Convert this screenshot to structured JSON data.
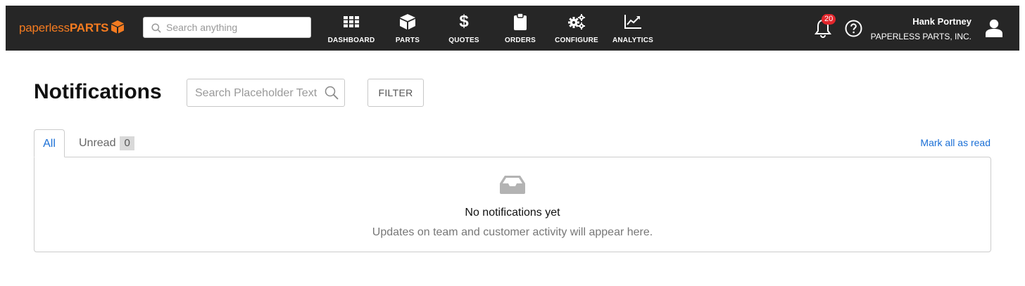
{
  "header": {
    "logo": {
      "light": "paperless",
      "bold": "PARTS"
    },
    "search_placeholder": "Search anything",
    "nav": [
      {
        "label": "DASHBOARD",
        "icon": "grid-icon"
      },
      {
        "label": "PARTS",
        "icon": "cube-icon"
      },
      {
        "label": "QUOTES",
        "icon": "dollar-icon"
      },
      {
        "label": "ORDERS",
        "icon": "clipboard-icon"
      },
      {
        "label": "CONFIGURE",
        "icon": "gears-icon"
      },
      {
        "label": "ANALYTICS",
        "icon": "chart-icon"
      }
    ],
    "notification_count": "20",
    "user_name": "Hank Portney",
    "user_org": "PAPERLESS PARTS, INC."
  },
  "page": {
    "title": "Notifications",
    "search_placeholder": "Search Placeholder Text",
    "filter_label": "FILTER",
    "tabs": {
      "all": "All",
      "unread": "Unread",
      "unread_count": "0"
    },
    "mark_all_label": "Mark all as read",
    "empty_title": "No notifications yet",
    "empty_subtitle": "Updates on team and customer activity will appear here."
  },
  "colors": {
    "accent": "#f47b20",
    "link": "#1a6fd6",
    "topbar": "#262626",
    "badge": "#e3262c"
  }
}
